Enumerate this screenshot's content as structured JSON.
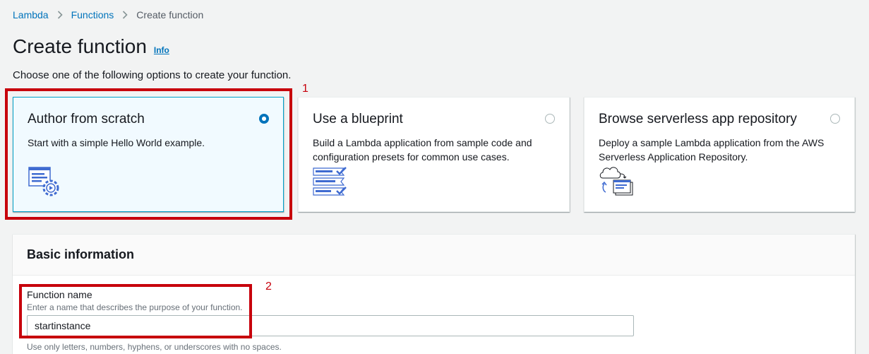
{
  "breadcrumb": {
    "items": [
      "Lambda",
      "Functions"
    ],
    "current": "Create function"
  },
  "page": {
    "title": "Create function",
    "info_link": "Info",
    "intro": "Choose one of the following options to create your function."
  },
  "options": [
    {
      "title": "Author from scratch",
      "description": "Start with a simple Hello World example.",
      "selected": true,
      "icon": "author-from-scratch-icon"
    },
    {
      "title": "Use a blueprint",
      "description": "Build a Lambda application from sample code and configuration presets for common use cases.",
      "selected": false,
      "icon": "blueprint-icon"
    },
    {
      "title": "Browse serverless app repository",
      "description": "Deploy a sample Lambda application from the AWS Serverless Application Repository.",
      "selected": false,
      "icon": "serverless-repo-icon"
    }
  ],
  "annotations": [
    "1",
    "2"
  ],
  "basic_info": {
    "heading": "Basic information",
    "function_name": {
      "label": "Function name",
      "description": "Enter a name that describes the purpose of your function.",
      "value": "startinstance",
      "constraint": "Use only letters, numbers, hyphens, or underscores with no spaces."
    }
  },
  "colors": {
    "link": "#0073bb",
    "selected_border": "#00a1c9",
    "selected_bg": "#f1faff",
    "annotation": "#c7000b",
    "page_bg": "#f2f3f3"
  }
}
